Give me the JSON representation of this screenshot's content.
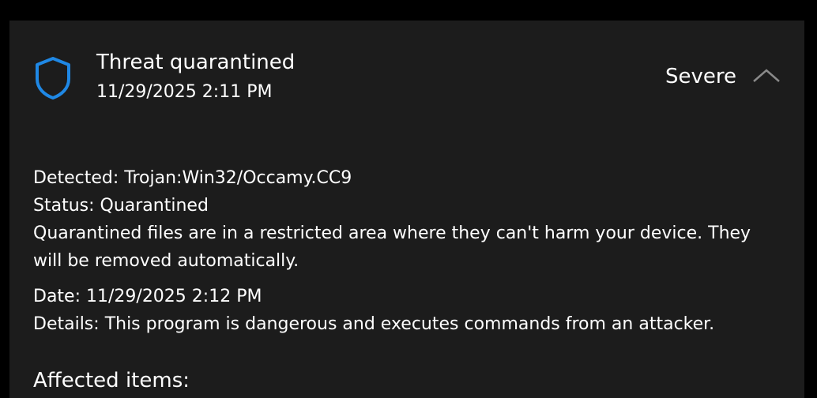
{
  "threat": {
    "title": "Threat quarantined",
    "datetime": "11/29/2025 2:11 PM",
    "severity": "Severe",
    "icon": "shield-icon",
    "collapse_icon": "chevron-up-icon",
    "accent_color": "#1f88e5"
  },
  "details": {
    "detected_label": "Detected:",
    "detected_value": "Trojan:Win32/Occamy.CC9",
    "status_label": "Status:",
    "status_value": "Quarantined",
    "status_description": "Quarantined files are in a restricted area where they can't harm your device. They will be removed automatically.",
    "date_label": "Date:",
    "date_value": "11/29/2025 2:12 PM",
    "details_label": "Details:",
    "details_value": "This program is dangerous and executes commands from an attacker."
  },
  "affected_items_label": "Affected items:"
}
